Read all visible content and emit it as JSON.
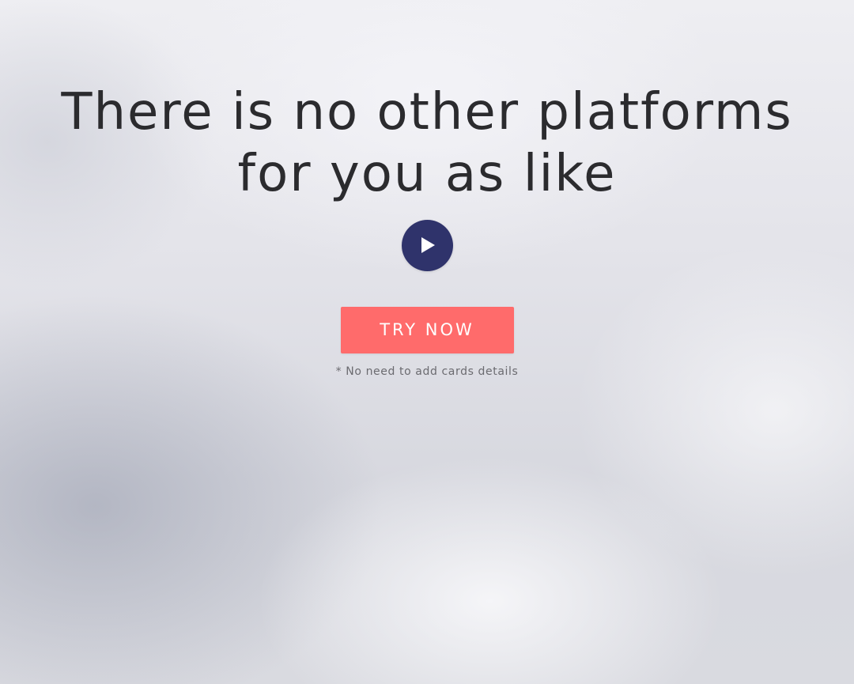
{
  "hero": {
    "headline": "There is no other platforms for you as like",
    "play_icon": "play-icon",
    "cta_label": "TRY NOW",
    "cta_note": "* No need to add cards details"
  },
  "colors": {
    "play_button": "#2f336b",
    "cta_button": "#ff6b6b",
    "headline_text": "#2b2b2e",
    "note_text": "#6b6b70"
  }
}
